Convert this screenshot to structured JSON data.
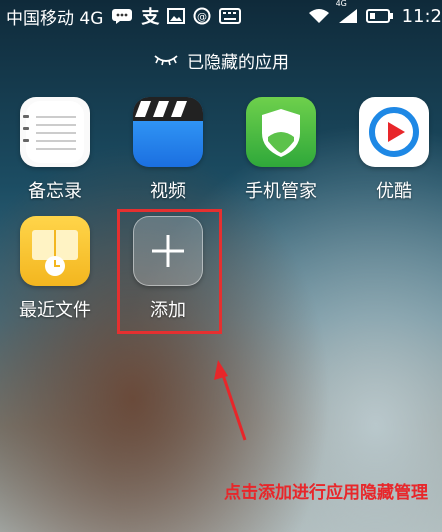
{
  "status_bar": {
    "carrier": "中国移动 4G",
    "signal_label": "4G",
    "time": "11:2"
  },
  "header": {
    "title": "已隐藏的应用"
  },
  "apps": [
    {
      "label": "备忘录",
      "icon": "notes-icon"
    },
    {
      "label": "视频",
      "icon": "video-icon"
    },
    {
      "label": "手机管家",
      "icon": "phone-manager-icon"
    },
    {
      "label": "优酷",
      "icon": "youku-icon"
    },
    {
      "label": "最近文件",
      "icon": "recent-files-icon"
    },
    {
      "label": "添加",
      "icon": "add-icon"
    }
  ],
  "annotation": {
    "text": "点击添加进行应用隐藏管理",
    "color": "#e8262a"
  }
}
